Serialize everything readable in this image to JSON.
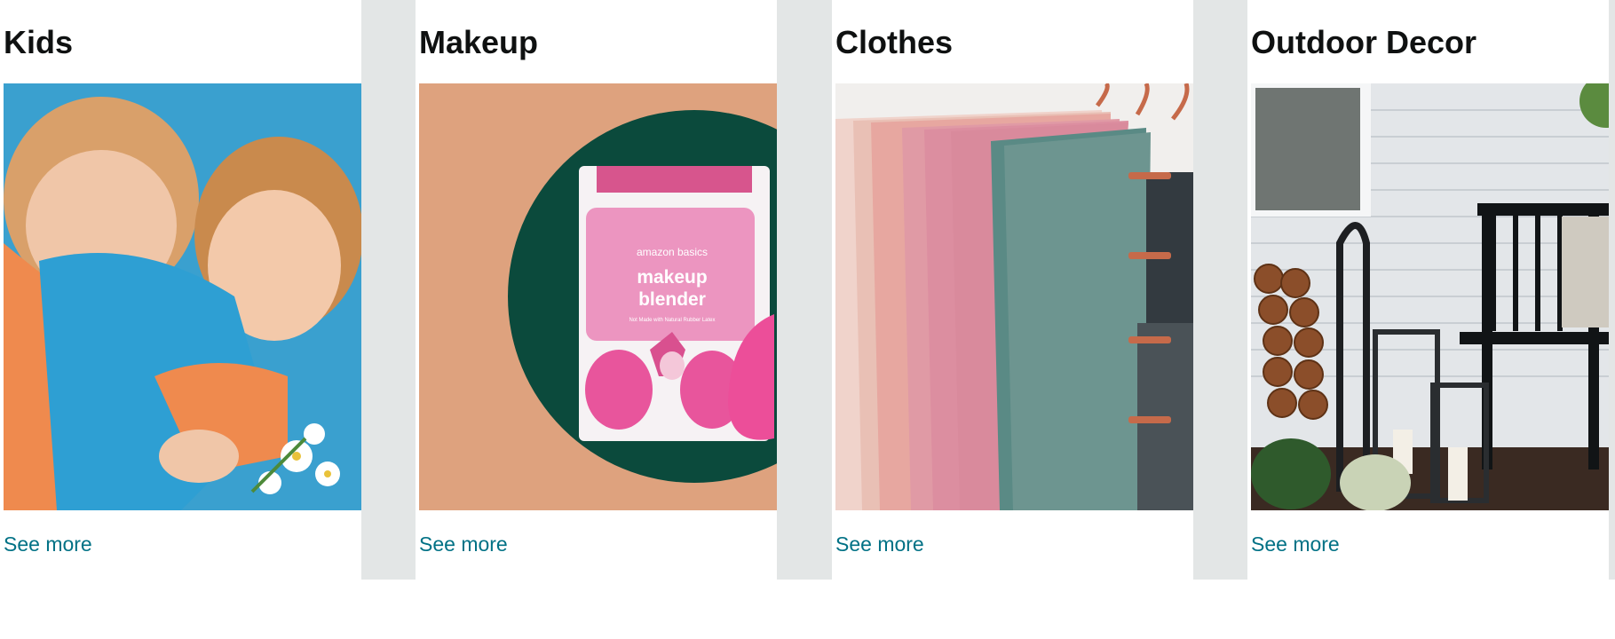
{
  "cards": [
    {
      "title": "Kids",
      "link": "See more",
      "image": "kids-hugging-photo"
    },
    {
      "title": "Makeup",
      "link": "See more",
      "image": "makeup-blender-photo",
      "product_brand": "amazon basics",
      "product_name_1": "makeup",
      "product_name_2": "blender",
      "product_sub": "Not Made with Natural Rubber Latex"
    },
    {
      "title": "Clothes",
      "link": "See more",
      "image": "clothes-rack-photo"
    },
    {
      "title": "Outdoor Decor",
      "link": "See more",
      "image": "outdoor-porch-photo"
    }
  ],
  "colors": {
    "link": "#007185",
    "title": "#0f1111",
    "divider": "#e3e6e6"
  }
}
